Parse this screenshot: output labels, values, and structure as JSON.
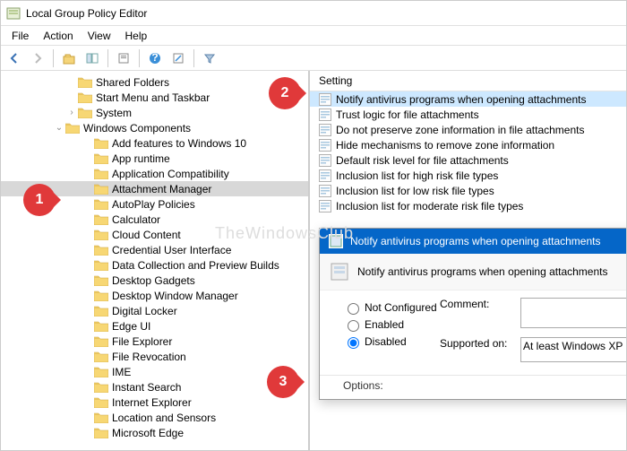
{
  "window": {
    "title": "Local Group Policy Editor"
  },
  "menu": {
    "file": "File",
    "action": "Action",
    "view": "View",
    "help": "Help"
  },
  "tree": {
    "top": [
      {
        "label": "Shared Folders",
        "indent": 72
      },
      {
        "label": "Start Menu and Taskbar",
        "indent": 72
      },
      {
        "label": "System",
        "indent": 72,
        "exp": "›"
      }
    ],
    "parent": {
      "label": "Windows Components",
      "indent": 58,
      "exp": "⌄"
    },
    "children": [
      "Add features to Windows 10",
      "App runtime",
      "Application Compatibility",
      "Attachment Manager",
      "AutoPlay Policies",
      "Calculator",
      "Cloud Content",
      "Credential User Interface",
      "Data Collection and Preview Builds",
      "Desktop Gadgets",
      "Desktop Window Manager",
      "Digital Locker",
      "Edge UI",
      "File Explorer",
      "File Revocation",
      "IME",
      "Instant Search",
      "Internet Explorer",
      "Location and Sensors",
      "Microsoft Edge"
    ],
    "selected": "Attachment Manager"
  },
  "list": {
    "header": "Setting",
    "items": [
      "Notify antivirus programs when opening attachments",
      "Trust logic for file attachments",
      "Do not preserve zone information in file attachments",
      "Hide mechanisms to remove zone information",
      "Default risk level for file attachments",
      "Inclusion list for high risk file types",
      "Inclusion list for low risk file types",
      "Inclusion list for moderate risk file types"
    ],
    "selected": "Notify antivirus programs when opening attachments"
  },
  "dialog": {
    "title": "Notify antivirus programs when opening attachments",
    "heading": "Notify antivirus programs when opening attachments",
    "opt_notconfig": "Not Configured",
    "opt_enabled": "Enabled",
    "opt_disabled": "Disabled",
    "comment_label": "Comment:",
    "supported_label": "Supported on:",
    "supported_value": "At least Windows XP P",
    "options_label": "Options:"
  },
  "callouts": {
    "c1": "1",
    "c2": "2",
    "c3": "3"
  },
  "watermark": "TheWindowsClub"
}
